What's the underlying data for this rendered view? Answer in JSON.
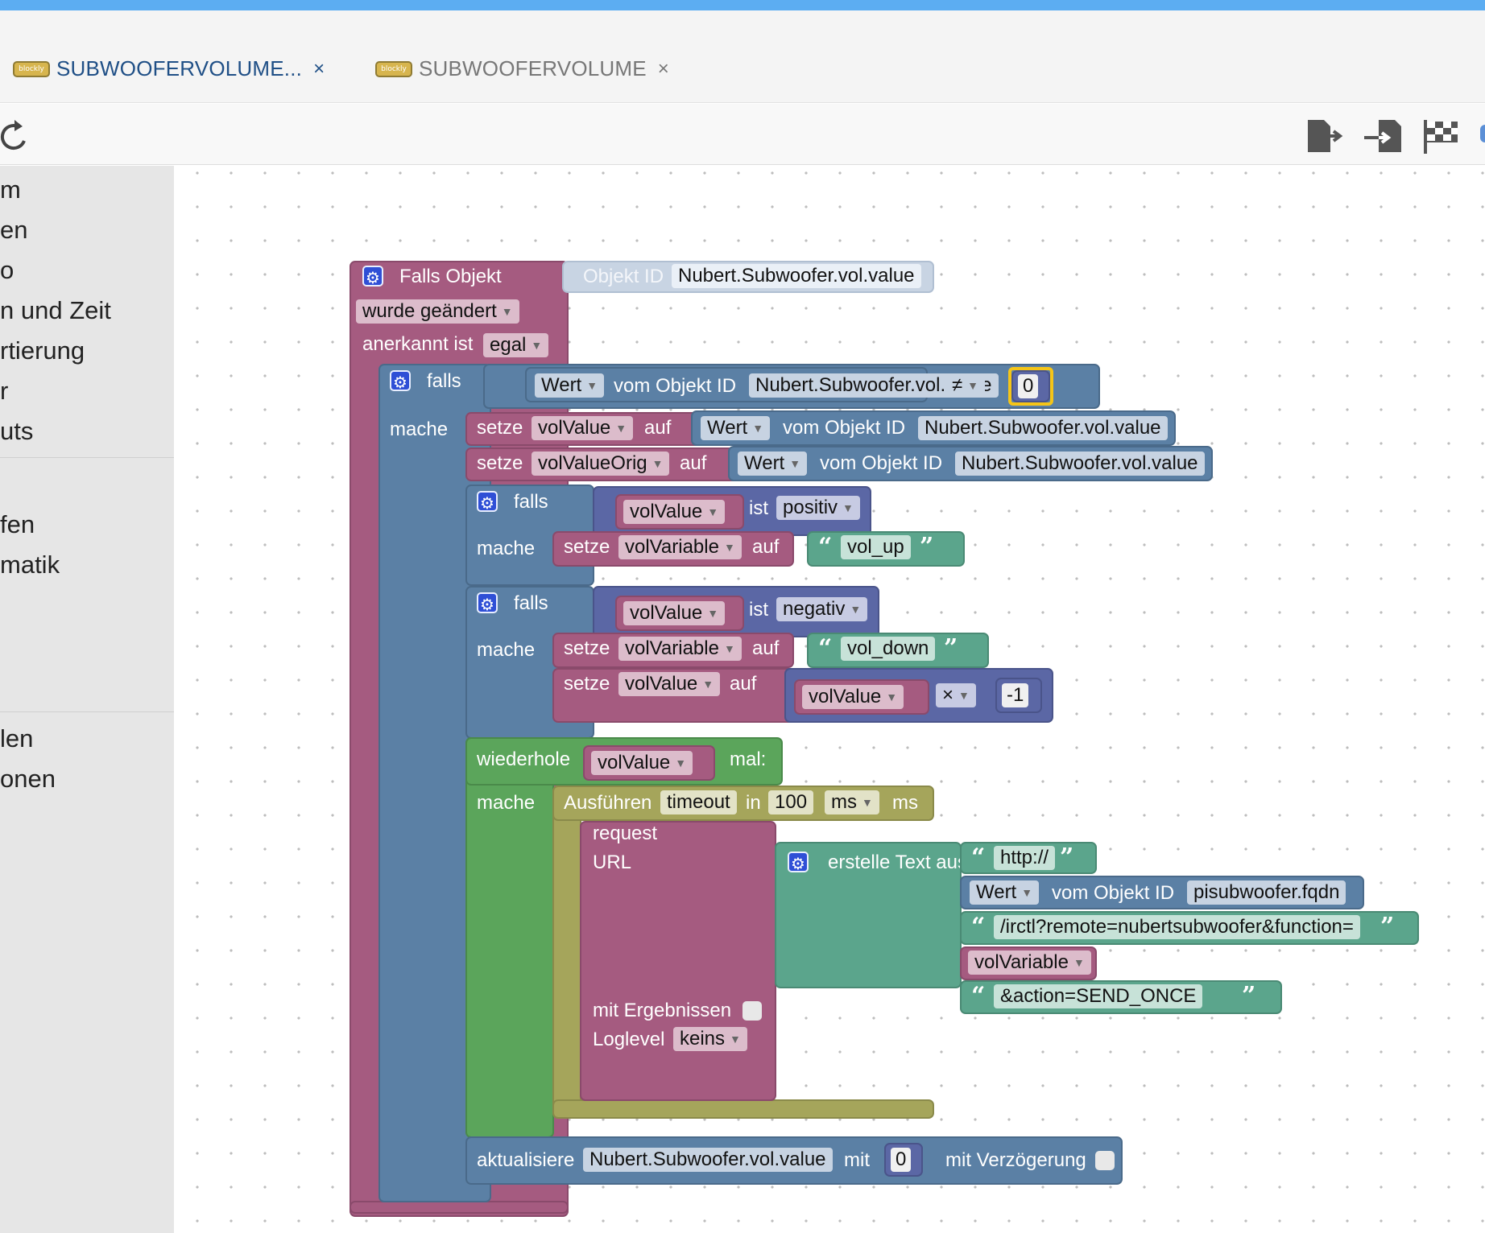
{
  "window": {
    "tabs": [
      {
        "label": "SUBWOOFERVOLUME...",
        "logo": "blockly",
        "close": "×"
      },
      {
        "label": "SUBWOOFERVOLUME",
        "logo": "blockly",
        "close": "×"
      }
    ]
  },
  "toolbar": {
    "refresh_icon": "refresh-icon",
    "export_icon": "export-icon",
    "import_icon": "import-icon",
    "flag_icon": "flag-icon"
  },
  "sidebar": {
    "items": [
      "m",
      "en",
      "o",
      "n und Zeit",
      "rtierung",
      "r",
      "uts",
      "fen",
      "matik",
      "len",
      "onen"
    ]
  },
  "blocks": {
    "trigger": {
      "title": "Falls Objekt",
      "object_label": "Objekt ID",
      "object_id": "Nubert.Subwoofer.vol.value",
      "changed": "wurde geändert",
      "ack_label": "anerkannt ist",
      "ack_value": "egal"
    },
    "if1": {
      "falls": "falls",
      "mache": "mache",
      "cond_attr": "Wert",
      "cond_of": "vom Objekt ID",
      "cond_id": "Nubert.Subwoofer.vol.value",
      "op": "≠",
      "value": "0"
    },
    "set1": {
      "setze": "setze",
      "var": "volValue",
      "auf": "auf",
      "attr": "Wert",
      "of": "vom Objekt ID",
      "id": "Nubert.Subwoofer.vol.value"
    },
    "set2": {
      "setze": "setze",
      "var": "volValueOrig",
      "auf": "auf",
      "attr": "Wert",
      "of": "vom Objekt ID",
      "id": "Nubert.Subwoofer.vol.value"
    },
    "if2": {
      "falls": "falls",
      "mache": "mache",
      "var": "volValue",
      "ist": "ist",
      "prop": "positiv",
      "setze": "setze",
      "set_var": "volVariable",
      "auf": "auf",
      "text": "vol_up"
    },
    "if3": {
      "falls": "falls",
      "mache": "mache",
      "var": "volValue",
      "ist": "ist",
      "prop": "negativ",
      "setze": "setze",
      "set_var": "volVariable",
      "auf": "auf",
      "text": "vol_down",
      "setze2": "setze",
      "set_var2": "volValue",
      "auf2": "auf",
      "mul_var": "volValue",
      "mul_op": "×",
      "mul_val": "-1"
    },
    "repeat": {
      "label": "wiederhole",
      "var": "volValue",
      "mal": "mal:",
      "mache": "mache"
    },
    "timeout": {
      "label": "Ausführen",
      "name": "timeout",
      "in": "in",
      "value": "100",
      "unit_sel": "ms",
      "unit": "ms"
    },
    "request": {
      "title": "request",
      "url": "URL",
      "results": "mit Ergebnissen",
      "loglevel_label": "Loglevel",
      "loglevel": "keins",
      "join": "erstelle Text aus",
      "p1": "http://",
      "p2_attr": "Wert",
      "p2_of": "vom Objekt ID",
      "p2_id": "pisubwoofer.fqdn",
      "p3": "/irctl?remote=nubertsubwoofer&function=",
      "p4": "volVariable",
      "p5": "&action=SEND_ONCE"
    },
    "update": {
      "label": "aktualisiere",
      "id": "Nubert.Subwoofer.vol.value",
      "mit": "mit",
      "value": "0",
      "delay": "mit Verzögerung"
    }
  },
  "colors": {
    "accent": "#5cadf2",
    "event": "#a55b80",
    "logic": "#5b80a5",
    "math": "#5b67a5",
    "text": "#5ba58c",
    "loop": "#5ba55b",
    "timeout": "#a5a55b"
  }
}
